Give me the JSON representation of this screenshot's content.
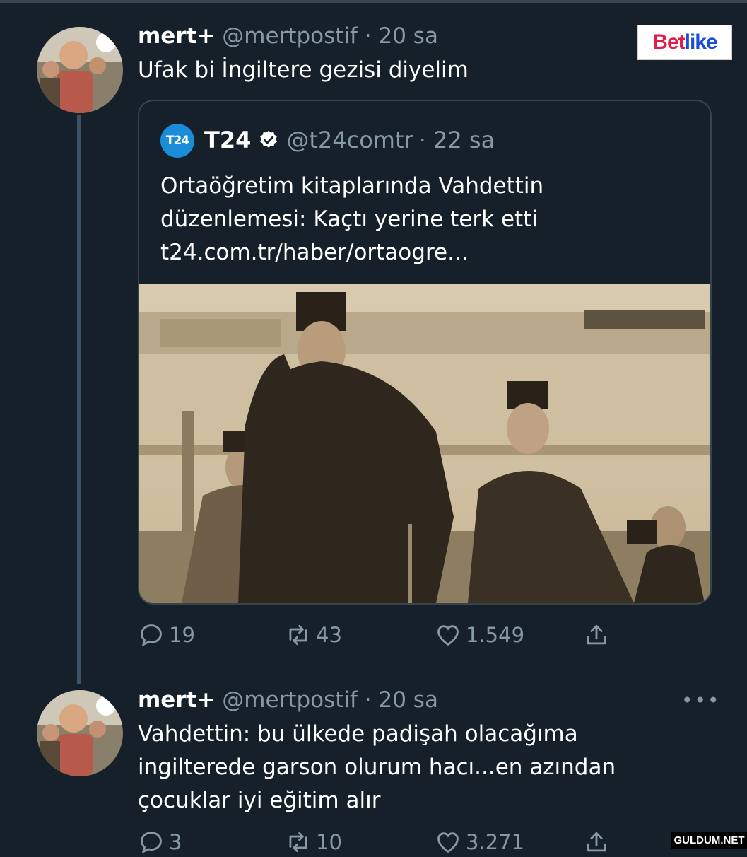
{
  "tweet1": {
    "display_name": "mert+",
    "handle": "@mertpostif",
    "time": "· 20 sa",
    "text": "Ufak bi İngiltere gezisi diyelim"
  },
  "brand_badge": {
    "part1": "Bet",
    "part2": "like"
  },
  "quoted": {
    "logo_text": "T24",
    "display_name": "T24",
    "handle": "@t24comtr",
    "time": "· 22 sa",
    "lines": [
      "Ortaöğretim kitaplarında Vahdettin",
      "düzenlemesi: Kaçtı yerine terk etti",
      "t24.com.tr/haber/ortaogre..."
    ]
  },
  "actions1": {
    "replies": "19",
    "retweets": "43",
    "likes": "1.549"
  },
  "tweet2": {
    "display_name": "mert+",
    "handle": "@mertpostif",
    "time": "· 20 sa",
    "more": "•••",
    "lines": [
      "Vahdettin: bu ülkede padişah olacağıma",
      "ingilterede garson olurum hacı...en azından",
      "çocuklar iyi eğitim alır"
    ]
  },
  "actions2": {
    "replies": "3",
    "retweets": "10",
    "likes": "3.271"
  },
  "watermark": "GULDUM.NET",
  "colors": {
    "background": "#15202b",
    "muted": "#8899a6",
    "border": "#38444d",
    "verified": "#ffffff"
  },
  "icons": [
    "reply-icon",
    "retweet-icon",
    "like-icon",
    "share-icon",
    "verified-icon"
  ]
}
